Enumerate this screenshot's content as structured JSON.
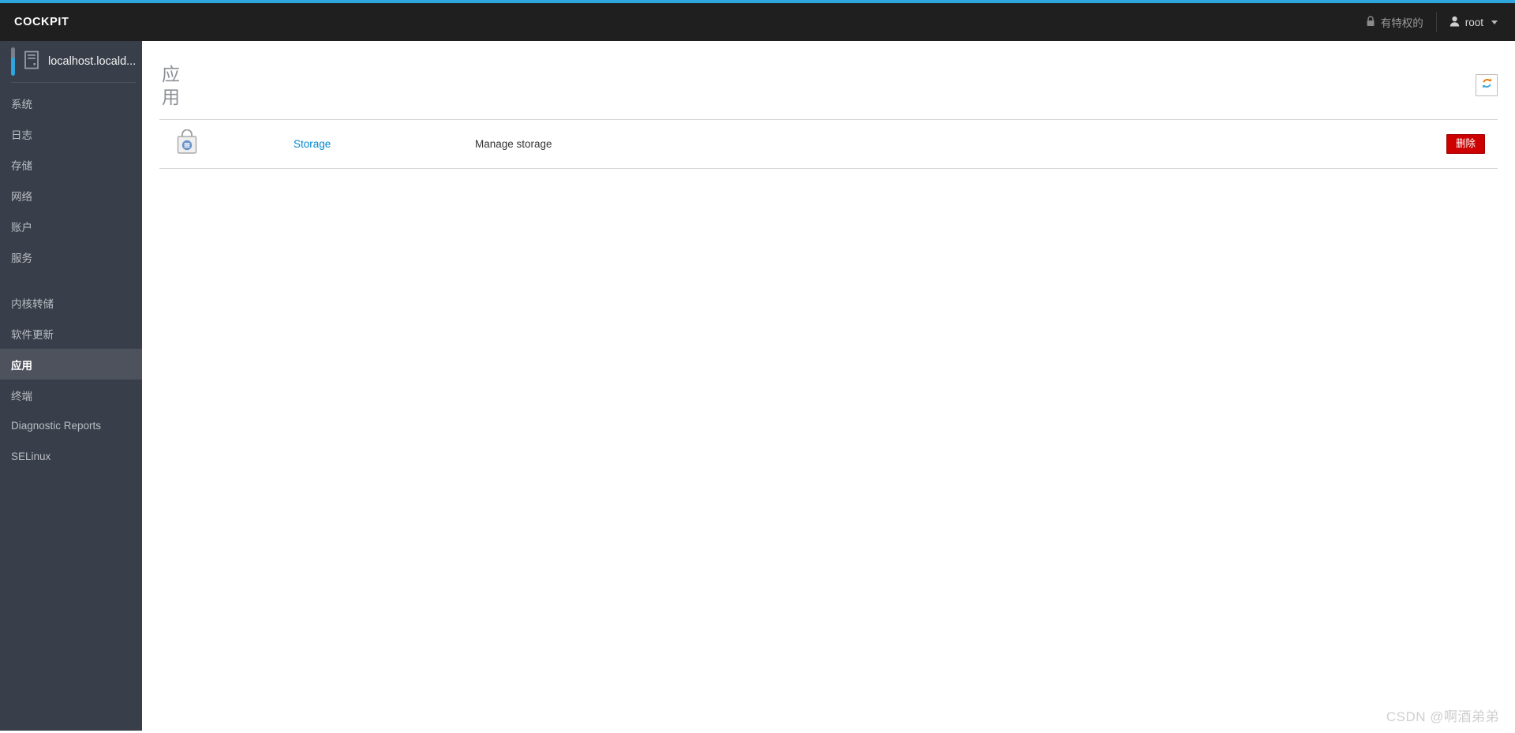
{
  "colors": {
    "accent": "#2fa5de",
    "masthead_bg": "#1f1f1f",
    "sidebar_bg": "#393f4a",
    "sidebar_active_bg": "#4d525c",
    "link_blue": "#0088ce",
    "danger_red": "#cc0000"
  },
  "masthead": {
    "brand": "COCKPIT",
    "privileged_label": "有特权的",
    "privileged_icon": "lock-icon",
    "user_label": "root",
    "user_icon": "user-icon",
    "caret_icon": "chevron-down-icon"
  },
  "sidebar": {
    "host": {
      "name": "localhost.locald...",
      "icon": "server-icon"
    },
    "items": [
      {
        "label": "系统",
        "name": "system",
        "active": false
      },
      {
        "label": "日志",
        "name": "logs",
        "active": false
      },
      {
        "label": "存储",
        "name": "storage",
        "active": false
      },
      {
        "label": "网络",
        "name": "network",
        "active": false
      },
      {
        "label": "账户",
        "name": "accounts",
        "active": false
      },
      {
        "label": "服务",
        "name": "services",
        "active": false
      }
    ],
    "items2": [
      {
        "label": "内核转储",
        "name": "kernel-dump",
        "active": false
      },
      {
        "label": "软件更新",
        "name": "software-updates",
        "active": false
      },
      {
        "label": "应用",
        "name": "applications",
        "active": true
      },
      {
        "label": "终端",
        "name": "terminal",
        "active": false
      },
      {
        "label": "Diagnostic Reports",
        "name": "diagnostic-reports",
        "active": false
      },
      {
        "label": "SELinux",
        "name": "selinux",
        "active": false
      }
    ]
  },
  "page": {
    "title": "应用",
    "refresh_icon": "refresh-icon"
  },
  "applications": {
    "rows": [
      {
        "icon": "app-package-icon",
        "name": "Storage",
        "description": "Manage storage",
        "action_label": "删除"
      }
    ]
  },
  "watermark": {
    "text": "CSDN @啊酒弟弟"
  }
}
